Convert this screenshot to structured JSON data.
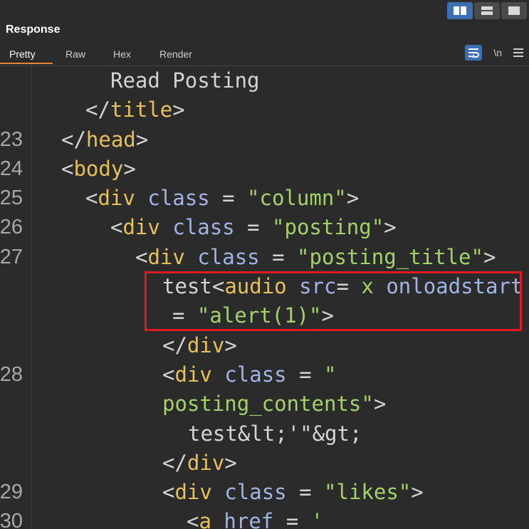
{
  "panel": {
    "title": "Response"
  },
  "tabs": [
    "Pretty",
    "Raw",
    "Hex",
    "Render"
  ],
  "toolbar": {
    "newline_label": "\\n"
  },
  "colors": {
    "accent": "#3d6fb5",
    "active_tab": "#e8822a",
    "highlight_box": "#e01b24"
  },
  "lines": [
    {
      "num": "",
      "indent": 155,
      "parts": [
        [
          "txt",
          "Read Posting"
        ]
      ]
    },
    {
      "num": "",
      "indent": 120,
      "parts": [
        [
          "punct",
          "</"
        ],
        [
          "tag",
          "title"
        ],
        [
          "punct",
          ">"
        ]
      ]
    },
    {
      "num": "23",
      "indent": 86,
      "parts": [
        [
          "punct",
          "</"
        ],
        [
          "tag",
          "head"
        ],
        [
          "punct",
          ">"
        ]
      ]
    },
    {
      "num": "24",
      "indent": 86,
      "parts": [
        [
          "punct",
          "<"
        ],
        [
          "tag",
          "body"
        ],
        [
          "punct",
          ">"
        ]
      ]
    },
    {
      "num": "25",
      "indent": 120,
      "parts": [
        [
          "punct",
          "<"
        ],
        [
          "tag",
          "div"
        ],
        [
          "punct",
          " "
        ],
        [
          "attr",
          "class"
        ],
        [
          "punct",
          " = "
        ],
        [
          "str",
          "\"column\""
        ],
        [
          "punct",
          ">"
        ]
      ]
    },
    {
      "num": "26",
      "indent": 155,
      "parts": [
        [
          "punct",
          "<"
        ],
        [
          "tag",
          "div"
        ],
        [
          "punct",
          " "
        ],
        [
          "attr",
          "class"
        ],
        [
          "punct",
          " = "
        ],
        [
          "str",
          "\"posting\""
        ],
        [
          "punct",
          ">"
        ]
      ]
    },
    {
      "num": "27",
      "indent": 190,
      "parts": [
        [
          "punct",
          "<"
        ],
        [
          "tag",
          "div"
        ],
        [
          "punct",
          " "
        ],
        [
          "attr",
          "class"
        ],
        [
          "punct",
          " = "
        ],
        [
          "str",
          "\"posting_title\""
        ],
        [
          "punct",
          ">"
        ]
      ]
    },
    {
      "num": "",
      "indent": 228,
      "parts": [
        [
          "txt",
          "test"
        ],
        [
          "punct",
          "<"
        ],
        [
          "tag",
          "audio"
        ],
        [
          "punct",
          " "
        ],
        [
          "attr",
          "src"
        ],
        [
          "punct",
          "= "
        ],
        [
          "str",
          "x"
        ],
        [
          "punct",
          " "
        ],
        [
          "attr",
          "onloadstart"
        ]
      ]
    },
    {
      "num": "",
      "indent": 242,
      "parts": [
        [
          "punct",
          "= "
        ],
        [
          "str",
          "\"alert(1)\""
        ],
        [
          "punct",
          ">"
        ]
      ]
    },
    {
      "num": "",
      "indent": 228,
      "parts": [
        [
          "punct",
          "</"
        ],
        [
          "tag",
          "div"
        ],
        [
          "punct",
          ">"
        ]
      ]
    },
    {
      "num": "28",
      "indent": 228,
      "parts": [
        [
          "punct",
          "<"
        ],
        [
          "tag",
          "div"
        ],
        [
          "punct",
          " "
        ],
        [
          "attr",
          "class"
        ],
        [
          "punct",
          " = "
        ],
        [
          "str",
          "\""
        ]
      ]
    },
    {
      "num": "",
      "indent": 228,
      "parts": [
        [
          "str",
          "posting_contents\""
        ],
        [
          "punct",
          ">"
        ]
      ]
    },
    {
      "num": "",
      "indent": 264,
      "parts": [
        [
          "txt",
          "test&lt;'\"&gt;"
        ]
      ]
    },
    {
      "num": "",
      "indent": 228,
      "parts": [
        [
          "punct",
          "</"
        ],
        [
          "tag",
          "div"
        ],
        [
          "punct",
          ">"
        ]
      ]
    },
    {
      "num": "29",
      "indent": 228,
      "parts": [
        [
          "punct",
          "<"
        ],
        [
          "tag",
          "div"
        ],
        [
          "punct",
          " "
        ],
        [
          "attr",
          "class"
        ],
        [
          "punct",
          " = "
        ],
        [
          "str",
          "\"likes\""
        ],
        [
          "punct",
          ">"
        ]
      ]
    },
    {
      "num": "30",
      "indent": 262,
      "parts": [
        [
          "punct",
          "<"
        ],
        [
          "tag",
          "a"
        ],
        [
          "punct",
          " "
        ],
        [
          "attr",
          "href"
        ],
        [
          "punct",
          " = "
        ],
        [
          "str",
          "'"
        ]
      ]
    }
  ]
}
